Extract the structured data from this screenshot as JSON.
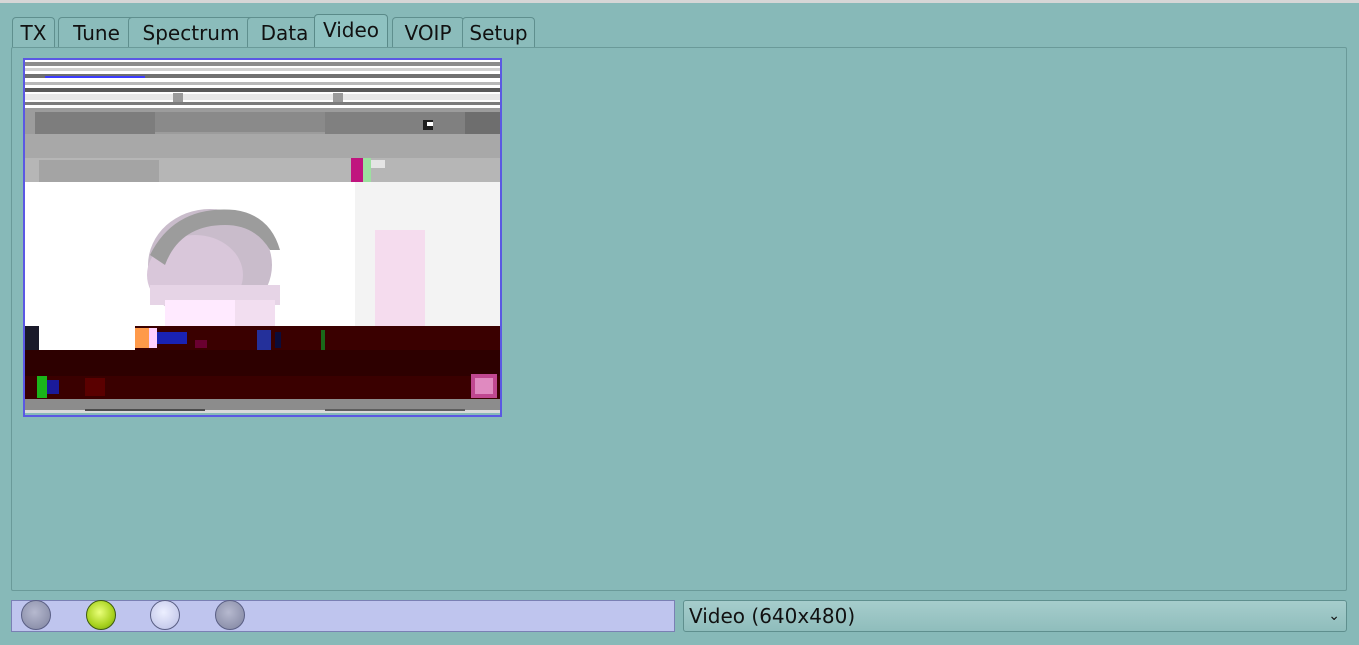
{
  "tabs": [
    {
      "label": "TX",
      "active": false
    },
    {
      "label": "Tune",
      "active": false
    },
    {
      "label": "Spectrum",
      "active": false
    },
    {
      "label": "Data",
      "active": false
    },
    {
      "label": "Video",
      "active": true
    },
    {
      "label": "VOIP",
      "active": false
    },
    {
      "label": "Setup",
      "active": false
    }
  ],
  "status_leds": [
    {
      "name": "led-1",
      "state": "off",
      "color": "#9599b3"
    },
    {
      "name": "led-2",
      "state": "on",
      "color": "#a8d21e"
    },
    {
      "name": "led-3",
      "state": "off",
      "color": "#c8ccec"
    },
    {
      "name": "led-4",
      "state": "off",
      "color": "#9599b3"
    }
  ],
  "video_mode": {
    "selected": "Video (640x480)",
    "chevron": "⌄"
  },
  "colors": {
    "background": "#87b9b8",
    "video_border": "#5b58e3",
    "status_bar": "#bfc5ee"
  }
}
